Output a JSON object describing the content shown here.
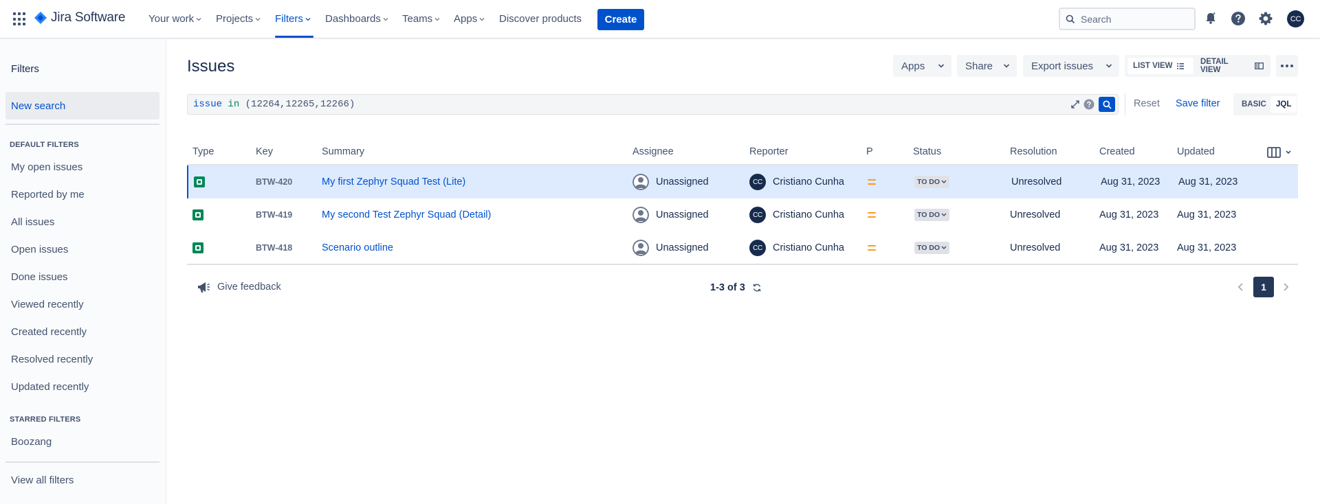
{
  "app": {
    "name": "Jira Software"
  },
  "nav": {
    "items": [
      {
        "label": "Your work"
      },
      {
        "label": "Projects"
      },
      {
        "label": "Filters"
      },
      {
        "label": "Dashboards"
      },
      {
        "label": "Teams"
      },
      {
        "label": "Apps"
      },
      {
        "label": "Discover products"
      }
    ],
    "create_label": "Create",
    "search_placeholder": "Search",
    "user_initials": "CC"
  },
  "sidebar": {
    "title": "Filters",
    "new_search": "New search",
    "default_heading": "DEFAULT FILTERS",
    "default_items": [
      "My open issues",
      "Reported by me",
      "All issues",
      "Open issues",
      "Done issues",
      "Viewed recently",
      "Created recently",
      "Resolved recently",
      "Updated recently"
    ],
    "starred_heading": "STARRED FILTERS",
    "starred_items": [
      "Boozang"
    ],
    "view_all": "View all filters"
  },
  "main": {
    "title": "Issues",
    "apps_label": "Apps",
    "share_label": "Share",
    "export_label": "Export issues",
    "list_view_label": "LIST VIEW",
    "detail_view_label": "DETAIL VIEW",
    "jql": {
      "keyword": "issue",
      "operator": "in",
      "rest": "(12264,12265,12266)"
    },
    "reset_label": "Reset",
    "save_filter_label": "Save filter",
    "basic_label": "BASIC",
    "jql_label": "JQL"
  },
  "table": {
    "columns": [
      "Type",
      "Key",
      "Summary",
      "Assignee",
      "Reporter",
      "P",
      "Status",
      "Resolution",
      "Created",
      "Updated"
    ],
    "rows": [
      {
        "key": "BTW-420",
        "summary": "My first Zephyr Squad Test (Lite)",
        "assignee": "Unassigned",
        "reporter_initials": "CC",
        "reporter": "Cristiano Cunha",
        "status": "TO DO",
        "resolution": "Unresolved",
        "created": "Aug 31, 2023",
        "updated": "Aug 31, 2023",
        "selected": true
      },
      {
        "key": "BTW-419",
        "summary": "My second Test Zephyr Squad (Detail)",
        "assignee": "Unassigned",
        "reporter_initials": "CC",
        "reporter": "Cristiano Cunha",
        "status": "TO DO",
        "resolution": "Unresolved",
        "created": "Aug 31, 2023",
        "updated": "Aug 31, 2023",
        "selected": false
      },
      {
        "key": "BTW-418",
        "summary": "Scenario outline",
        "assignee": "Unassigned",
        "reporter_initials": "CC",
        "reporter": "Cristiano Cunha",
        "status": "TO DO",
        "resolution": "Unresolved",
        "created": "Aug 31, 2023",
        "updated": "Aug 31, 2023",
        "selected": false
      }
    ]
  },
  "footer": {
    "feedback_label": "Give feedback",
    "count_label": "1-3 of 3",
    "current_page": "1"
  },
  "colors": {
    "brand": "#0052cc",
    "selected_row": "#deebff",
    "priority_medium": "#ff991f",
    "type_test": "#00875a"
  }
}
